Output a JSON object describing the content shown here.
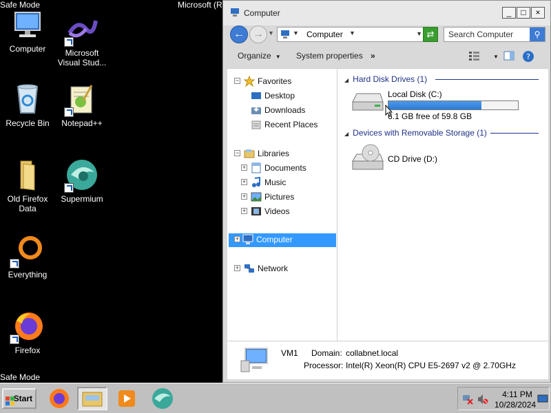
{
  "desktop": {
    "safe_mode_top": "Safe Mode",
    "safe_mode_bottom": "Safe Mode",
    "top_right_text": "Microsoft (R",
    "icons": [
      {
        "label": "Computer",
        "icon": "computer-icon"
      },
      {
        "label": "Microsoft Visual Stud...",
        "icon": "visual-studio-icon"
      },
      {
        "label": "Recycle Bin",
        "icon": "recycle-bin-icon"
      },
      {
        "label": "Notepad++",
        "icon": "notepad-plus-plus-icon"
      },
      {
        "label": "Old Firefox Data",
        "icon": "folder-icon"
      },
      {
        "label": "Supermium",
        "icon": "supermium-icon"
      },
      {
        "label": "Everything",
        "icon": "everything-icon"
      },
      {
        "label": "Firefox",
        "icon": "firefox-icon"
      }
    ]
  },
  "window": {
    "title": "Computer",
    "controls": {
      "minimize": "_",
      "maximize": "□",
      "close": "×"
    },
    "address": {
      "location": "Computer"
    },
    "search": {
      "placeholder": "Search Computer"
    },
    "toolbar": {
      "organize": "Organize",
      "system_properties": "System properties",
      "more": "»"
    },
    "nav": {
      "favorites": {
        "label": "Favorites",
        "items": [
          "Desktop",
          "Downloads",
          "Recent Places"
        ]
      },
      "libraries": {
        "label": "Libraries",
        "items": [
          "Documents",
          "Music",
          "Pictures",
          "Videos"
        ]
      },
      "computer": "Computer",
      "network": "Network"
    },
    "content": {
      "hard_disk_group": "Hard Disk Drives (1)",
      "local_disk": {
        "name": "Local Disk (C:)",
        "free_text": "6.1 GB free of 59.8 GB",
        "used_fraction": 0.72
      },
      "removable_group": "Devices with Removable Storage (1)",
      "cd_drive": {
        "name": "CD Drive (D:)"
      }
    },
    "details": {
      "name": "VM1",
      "domain_label": "Domain:",
      "domain_value": "collabnet.local",
      "processor_label": "Processor:",
      "processor_value": "Intel(R) Xeon(R) CPU E5-2697 v2 @ 2.70GHz"
    }
  },
  "taskbar": {
    "start_label": "Start",
    "apps": [
      "firefox-icon",
      "file-explorer-icon",
      "media-player-icon",
      "supermium-icon"
    ],
    "clock": {
      "time": "4:11 PM",
      "date": "10/28/2024"
    }
  },
  "colors": {
    "selection": "#3399ff",
    "group_header": "#1e3287",
    "progress": "#2a7bd7"
  }
}
